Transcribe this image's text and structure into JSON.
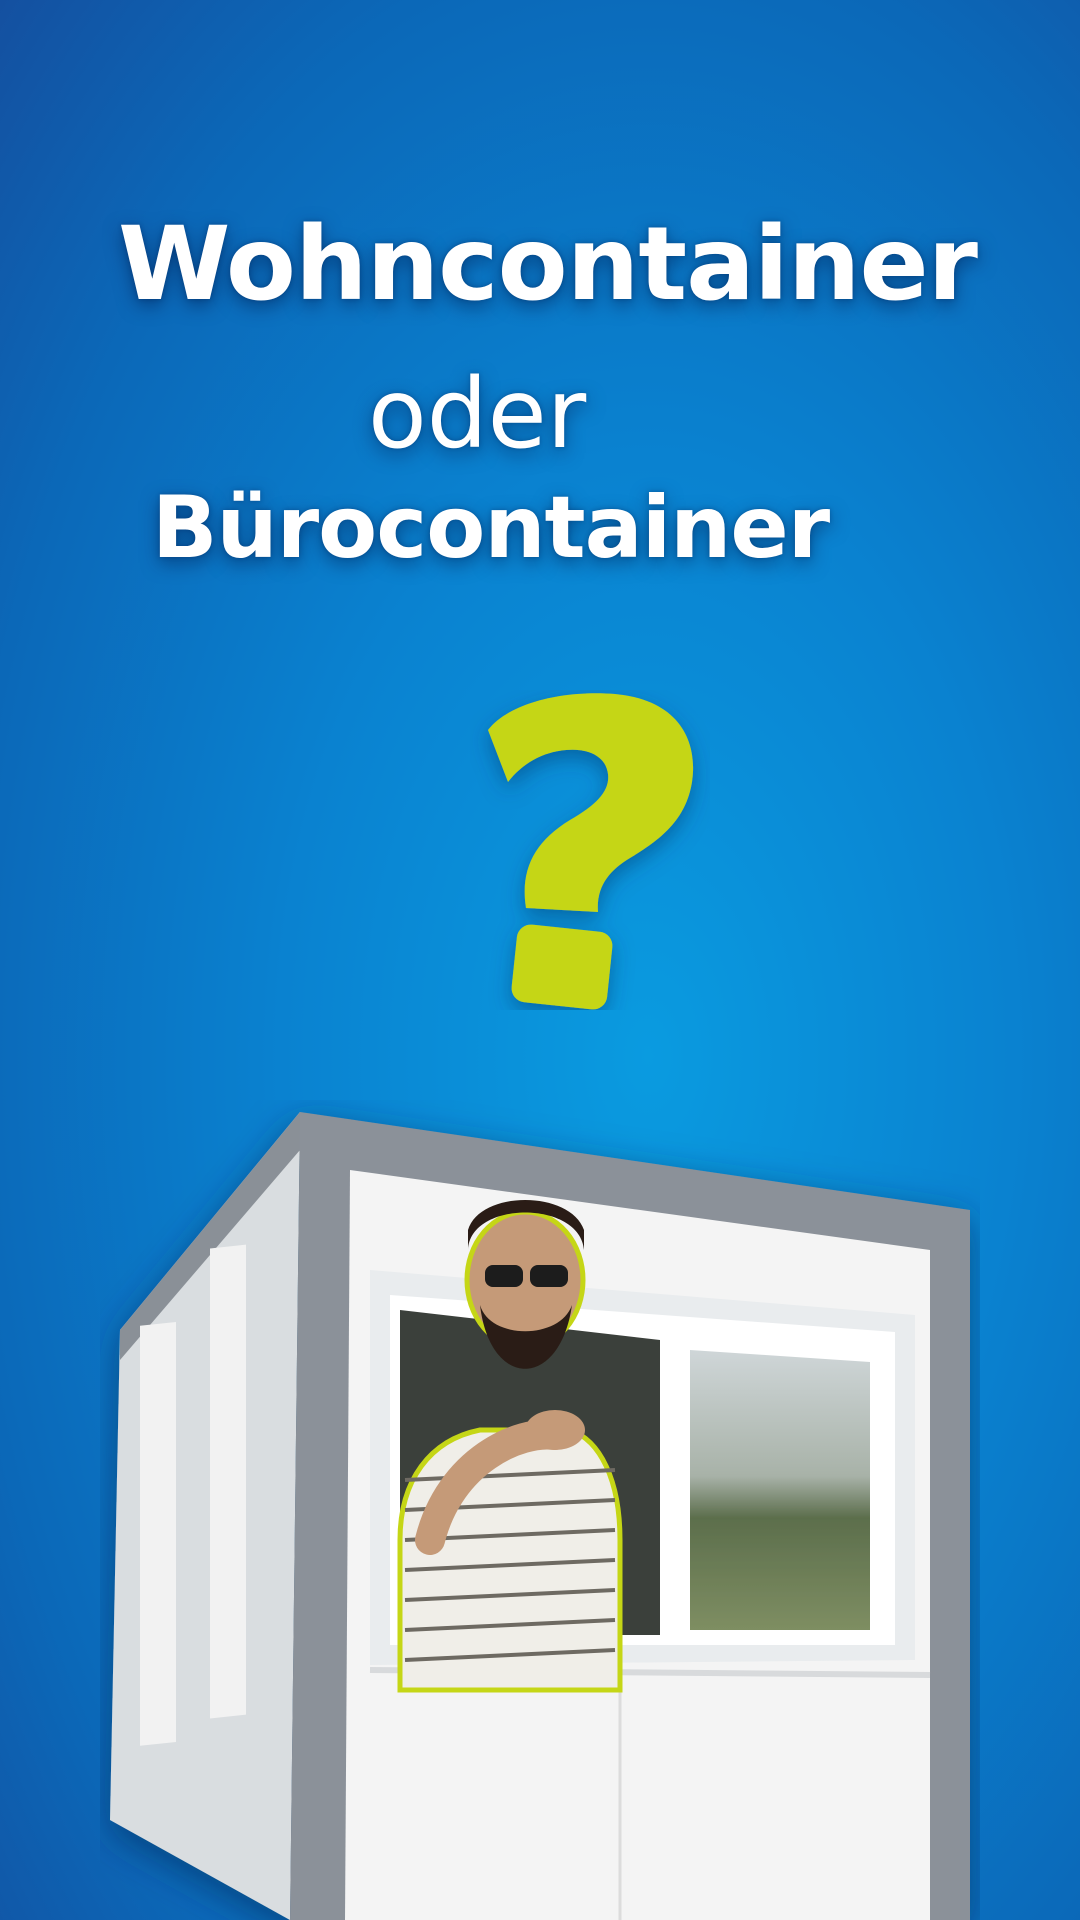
{
  "headline": {
    "line1": "Wohncontainer",
    "line2": "oder",
    "line3": "Bürocontainer"
  },
  "question_mark": {
    "symbol": "?",
    "color": "#c5d614"
  },
  "colors": {
    "background": "#0a8ad6",
    "text": "#ffffff",
    "accent": "#c5d614"
  },
  "image": {
    "subject": "container-with-man-in-window"
  }
}
